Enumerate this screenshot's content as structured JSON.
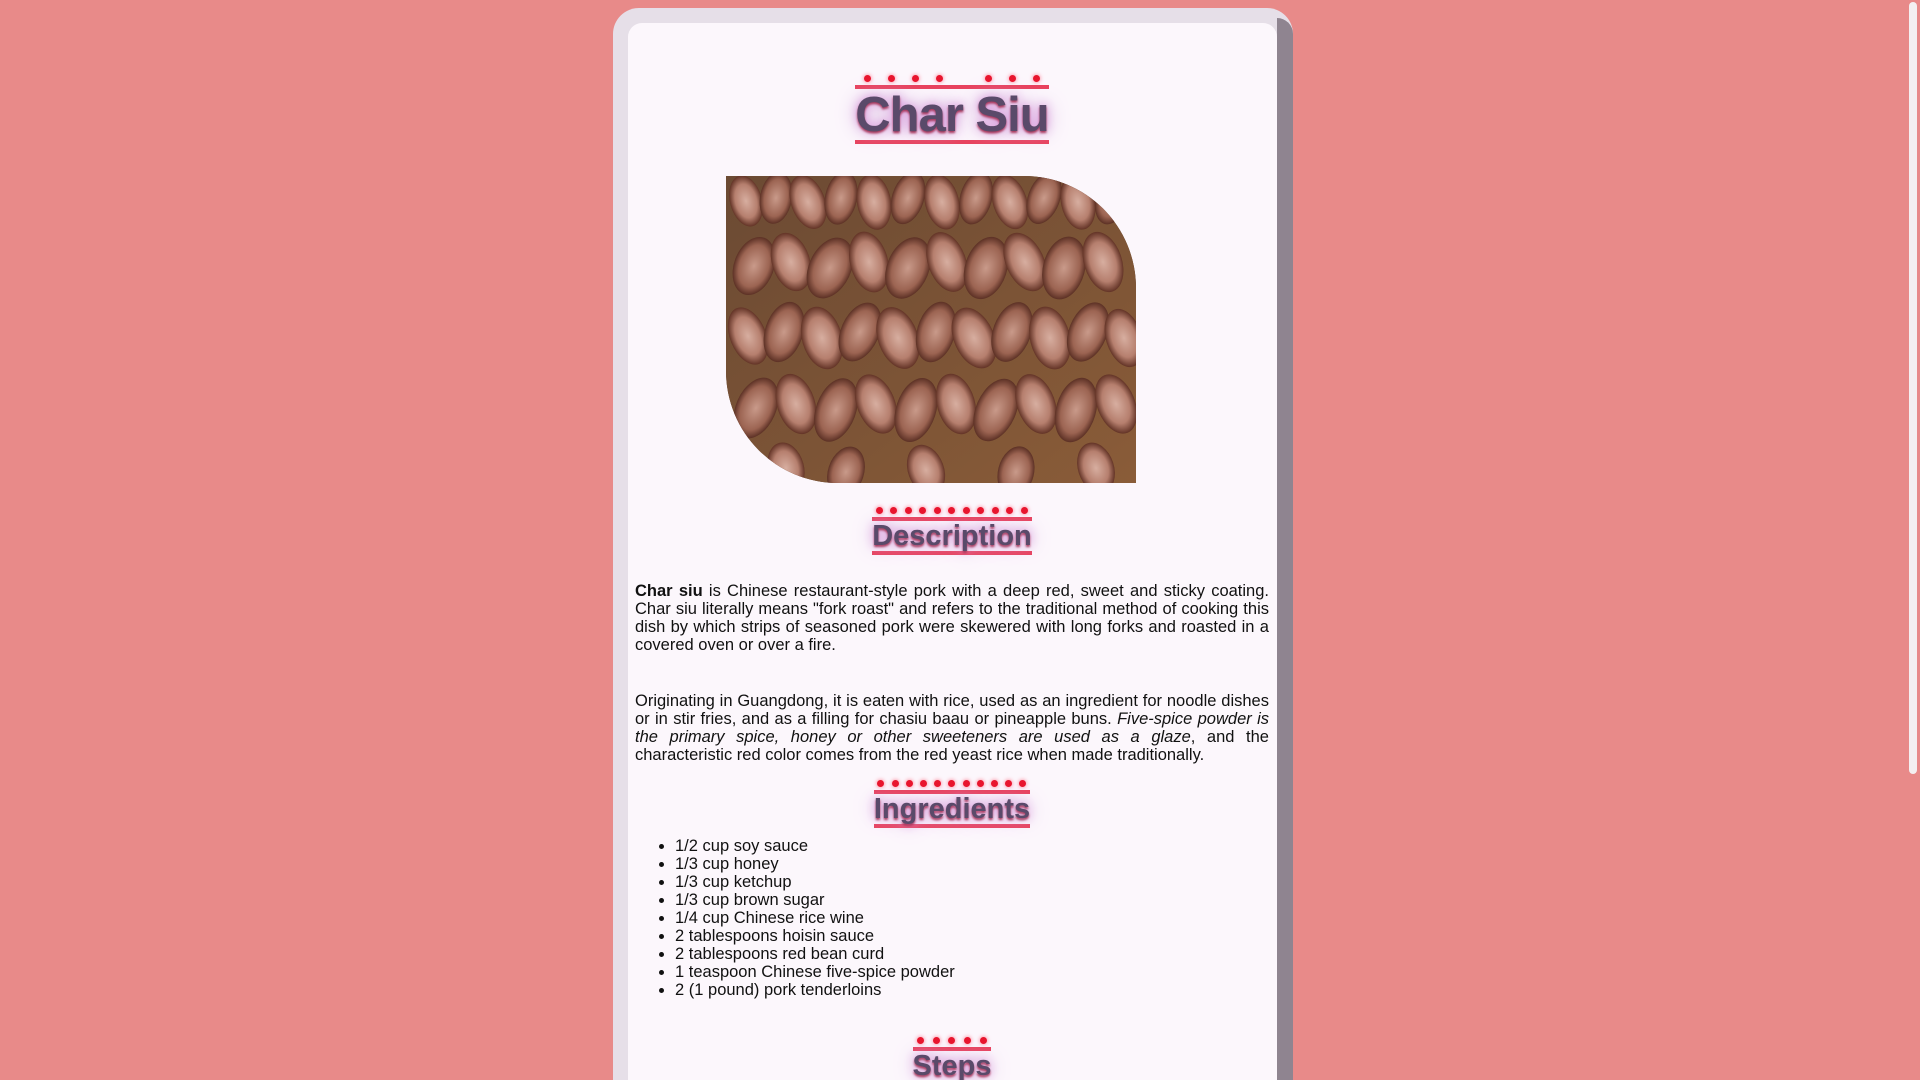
{
  "page": {
    "title": "Char Siu",
    "image_alt": "Sliced char siu pork on a wooden board"
  },
  "description": {
    "heading": "Description",
    "p1_bold": "Char siu",
    "p1_rest": " is Chinese restaurant-style pork with a deep red, sweet and sticky coating. Char siu literally means \"fork roast\" and refers to the traditional method of cooking this dish by which strips of seasoned pork were skewered with long forks and roasted in a covered oven or over a fire.",
    "p2_start": "Originating in Guangdong, it is eaten with rice, used as an ingredient for noodle dishes or in stir fries, and as a filling for chasiu baau or pineapple buns. ",
    "p2_italic": "Five-spice powder is the primary spice, honey or other sweeteners are used as a glaze",
    "p2_end": ", and the characteristic red color comes from the red yeast rice when made traditionally."
  },
  "ingredients": {
    "heading": "Ingredients",
    "items": [
      "1/2 cup soy sauce",
      "1/3 cup honey",
      "1/3 cup ketchup",
      "1/3 cup brown sugar",
      "1/4 cup Chinese rice wine",
      "2 tablespoons hoisin sauce",
      "2 tablespoons red bean curd",
      "1 teaspoon Chinese five-spice powder",
      "2 (1 pound) pork tenderloins"
    ]
  },
  "steps": {
    "heading": "Steps"
  },
  "colors": {
    "background": "#e88a89",
    "card": "#fcf7fc",
    "heading_text": "#5a4a6a",
    "heading_rule": "#e8415c",
    "heading_dots": "#e8152e"
  }
}
